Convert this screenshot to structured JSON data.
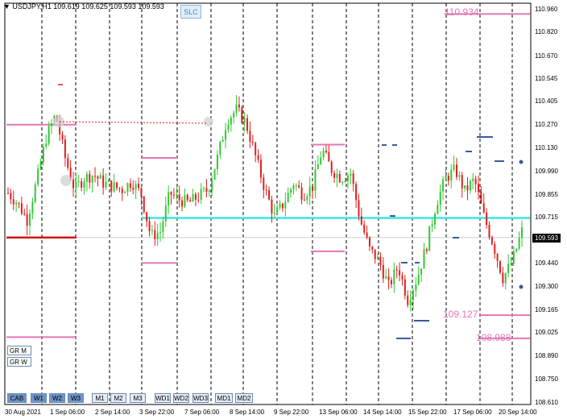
{
  "window": {
    "symbol_line": "USDJPY,H1  109.619 109.625 109.593 109.593",
    "current_price": "109.593"
  },
  "slc_button": "SLC",
  "toolbar": [
    {
      "label": "CAB",
      "active": true
    },
    {
      "label": "W1",
      "active": true
    },
    {
      "label": "W2",
      "active": true
    },
    {
      "label": "W3",
      "active": true
    },
    {
      "label": "M1",
      "active": false
    },
    {
      "label": "M2",
      "active": false
    },
    {
      "label": "M3",
      "active": false
    },
    {
      "label": "WD1",
      "active": false
    },
    {
      "label": "WD2",
      "active": false
    },
    {
      "label": "WD3",
      "active": false
    },
    {
      "label": "MD1",
      "active": false
    },
    {
      "label": "MD2",
      "active": false
    }
  ],
  "side_buttons": [
    "GR M",
    "GR W"
  ],
  "y_axis": {
    "min": 108.61,
    "max": 110.96,
    "ticks": [
      "110.960",
      "110.820",
      "110.670",
      "110.545",
      "110.405",
      "110.270",
      "110.130",
      "109.990",
      "109.855",
      "109.715",
      "109.593",
      "109.440",
      "109.300",
      "109.165",
      "109.025",
      "108.890",
      "108.750",
      "108.610"
    ]
  },
  "x_axis": {
    "ticks": [
      "30 Aug 2021",
      "1 Sep 06:00",
      "2 Sep 14:00",
      "3 Sep 22:00",
      "7 Sep 06:00",
      "8 Sep 14:00",
      "9 Sep 22:00",
      "13 Sep 06:00",
      "14 Sep 14:00",
      "15 Sep 22:00",
      "17 Sep 06:00",
      "20 Sep 14:00"
    ]
  },
  "level_labels": [
    "110.934",
    "109.127",
    "108.988"
  ],
  "colors": {
    "bull": "#32c832",
    "bear": "#e11e1e",
    "pink_level": "#e377b6",
    "cyan_level": "#38e6e6",
    "red_level": "#d21414",
    "navy_dash": "#3a5aa0"
  },
  "chart_data": {
    "type": "candlestick",
    "symbol": "USDJPY",
    "timeframe": "H1",
    "ylim": [
      108.61,
      110.96
    ],
    "close_path": [
      109.86,
      109.8,
      109.7,
      109.93,
      110.19,
      110.33,
      110.07,
      109.88,
      109.95,
      109.97,
      109.92,
      109.9,
      109.88,
      109.93,
      109.85,
      109.6,
      109.63,
      109.86,
      109.82,
      109.8,
      109.84,
      109.88,
      110.07,
      110.3,
      110.36,
      110.28,
      110.08,
      109.88,
      109.72,
      109.8,
      109.92,
      109.85,
      109.9,
      110.12,
      110.0,
      109.95,
      109.98,
      109.7,
      109.52,
      109.45,
      109.3,
      109.42,
      109.22,
      109.35,
      109.55,
      109.8,
      109.95,
      110.0,
      109.87,
      109.94,
      109.72,
      109.55,
      109.35,
      109.45,
      109.63
    ],
    "horizontal_levels": [
      {
        "price": 110.934,
        "label": "110.934",
        "color": "pink"
      },
      {
        "price": 110.27,
        "color": "pink"
      },
      {
        "price": 110.07,
        "color": "pink"
      },
      {
        "price": 110.15,
        "color": "pink"
      },
      {
        "price": 109.71,
        "color": "cyan"
      },
      {
        "price": 109.593,
        "color": "red"
      },
      {
        "price": 109.44,
        "color": "pink"
      },
      {
        "price": 109.51,
        "color": "pink"
      },
      {
        "price": 109.127,
        "label": "109.127",
        "color": "pink"
      },
      {
        "price": 108.988,
        "label": "108.988",
        "color": "pink"
      }
    ]
  }
}
